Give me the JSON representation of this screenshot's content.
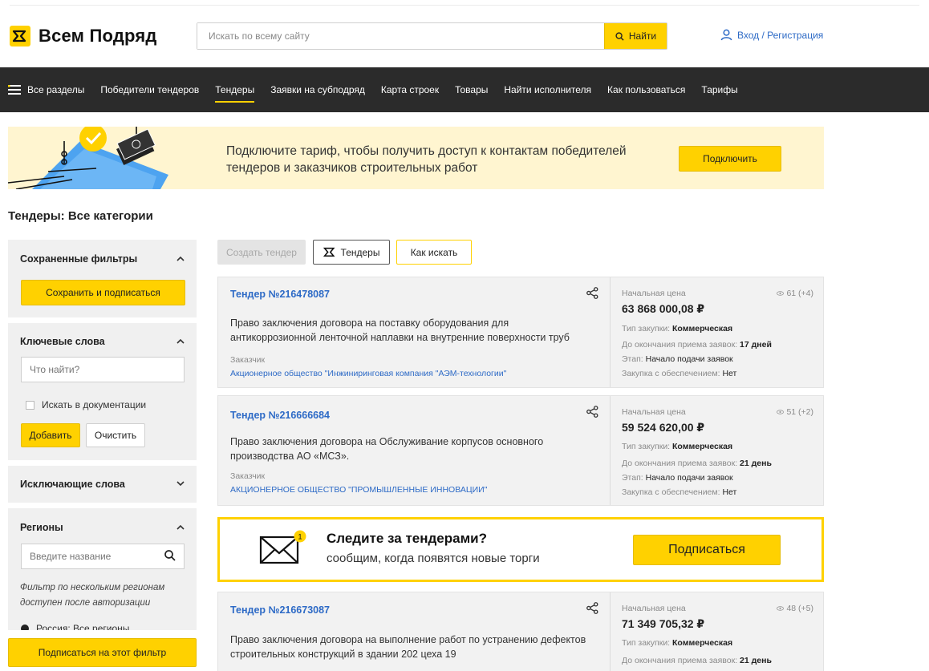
{
  "header": {
    "logo_text": "Всем Подряд",
    "search_placeholder": "Искать по всему сайту",
    "search_button": "Найти",
    "login_link": "Вход / Регистрация"
  },
  "nav": {
    "items": [
      {
        "label": "Все разделы"
      },
      {
        "label": "Победители тендеров"
      },
      {
        "label": "Тендеры",
        "active": true
      },
      {
        "label": "Заявки на субподряд"
      },
      {
        "label": "Карта строек"
      },
      {
        "label": "Товары"
      },
      {
        "label": "Найти исполнителя"
      },
      {
        "label": "Как пользоваться"
      },
      {
        "label": "Тарифы"
      }
    ]
  },
  "banner": {
    "text": "Подключите тариф, чтобы получить доступ к контактам победителей тендеров и заказчиков строительных работ",
    "button": "Подключить"
  },
  "page_title": "Тендеры: Все категории",
  "sidebar": {
    "saved_filters": {
      "title": "Сохраненные фильтры",
      "button": "Сохранить и подписаться"
    },
    "keywords": {
      "title": "Ключевые слова",
      "placeholder": "Что найти?",
      "checkbox_label": "Искать в документации",
      "add_button": "Добавить",
      "clear_button": "Очистить"
    },
    "exclude": {
      "title": "Исключающие слова"
    },
    "regions": {
      "title": "Регионы",
      "placeholder": "Введите название",
      "note": "Фильтр по нескольким регионам доступен после авторизации",
      "radio_label": "Россия: Все регионы"
    },
    "subscribe_filter_button": "Подписаться на этот фильтр"
  },
  "actions": {
    "create": "Создать тендер",
    "tenders": "Тендеры",
    "how": "Как искать"
  },
  "tenders": [
    {
      "title": "Тендер №216478087",
      "description": "Право заключения договора на поставку оборудования для антикоррозионной ленточной наплавки на внутренние поверхности труб",
      "customer_label": "Заказчик",
      "customer": "Акционерное общество \"Инжиниринговая компания \"АЭМ-технологии\"",
      "price_label": "Начальная цена",
      "price": "63 868 000,08 ₽",
      "views": "61 (+4)",
      "type_label": "Тип закупки: ",
      "type": "Коммерческая",
      "deadline_label": "До окончания приема заявок: ",
      "deadline": "17 дней",
      "stage_label": "Этап: ",
      "stage": "Начало подачи заявок",
      "security_label": "Закупка с обеспечением: ",
      "security": "Нет"
    },
    {
      "title": "Тендер №216666684",
      "description": "Право заключения договора на Обслуживание корпусов основного производства АО «МСЗ».",
      "customer_label": "Заказчик",
      "customer": "АКЦИОНЕРНОЕ ОБЩЕСТВО \"ПРОМЫШЛЕННЫЕ ИННОВАЦИИ\"",
      "price_label": "Начальная цена",
      "price": "59 524 620,00 ₽",
      "views": "51 (+2)",
      "type_label": "Тип закупки: ",
      "type": "Коммерческая",
      "deadline_label": "До окончания приема заявок: ",
      "deadline": "21 день",
      "stage_label": "Этап: ",
      "stage": "Начало подачи заявок",
      "security_label": "Закупка с обеспечением: ",
      "security": "Нет"
    },
    {
      "title": "Тендер №216673087",
      "description": "Право заключения договора на выполнение работ по устранению дефектов строительных конструкций в здании 202 цеха 19",
      "price_label": "Начальная цена",
      "price": "71 349 705,32 ₽",
      "views": "48 (+5)",
      "type_label": "Тип закупки: ",
      "type": "Коммерческая",
      "deadline_label": "До окончания приема заявок: ",
      "deadline": "21 день"
    }
  ],
  "subscribe": {
    "title": "Следите за тендерами?",
    "text": "сообщим, когда появятся новые торги",
    "button": "Подписаться",
    "badge": "1"
  },
  "colors": {
    "accent": "#ffd100",
    "nav_bg": "#2b2b2b",
    "link": "#2d6ac6",
    "banner_bg": "#fff5d0",
    "card_bg": "#f2f2f2"
  }
}
